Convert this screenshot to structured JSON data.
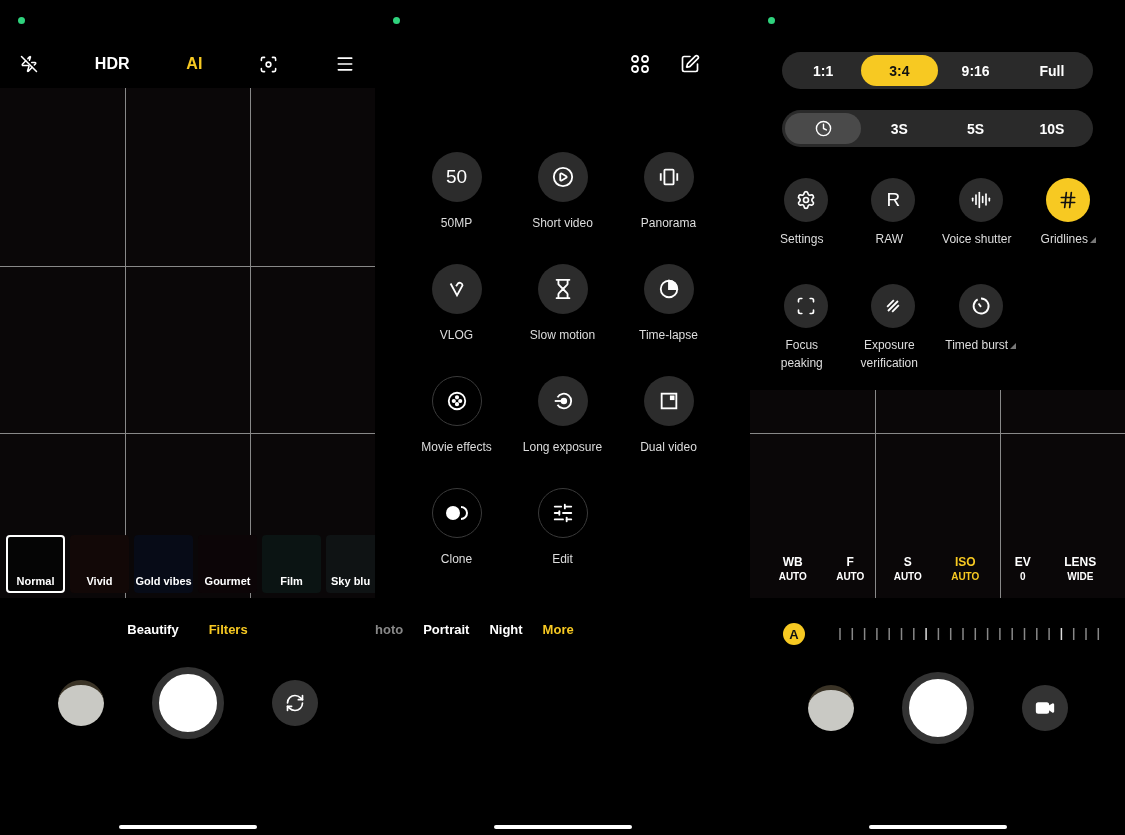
{
  "filter_screen": {
    "top_bar": [
      {
        "label": "HDR",
        "selected": false
      },
      {
        "label": "AI",
        "selected": true
      }
    ],
    "filters": [
      {
        "label": "Normal",
        "selected": true,
        "color": "#050505"
      },
      {
        "label": "Vivid",
        "selected": false,
        "color": "#120807"
      },
      {
        "label": "Gold vibes",
        "selected": false,
        "color": "#070b17"
      },
      {
        "label": "Gourmet",
        "selected": false,
        "color": "#0c0507"
      },
      {
        "label": "Film",
        "selected": false,
        "color": "#0b1413"
      },
      {
        "label": "Sky blu",
        "selected": false,
        "color": "#0f1314"
      }
    ],
    "tabs": [
      {
        "label": "Beautify",
        "selected": false
      },
      {
        "label": "Filters",
        "selected": true
      }
    ]
  },
  "more_screen": {
    "modes": [
      {
        "label": "50MP",
        "kind": "filled",
        "glyph": "50"
      },
      {
        "label": "Short video",
        "kind": "filled"
      },
      {
        "label": "Panorama",
        "kind": "filled"
      },
      {
        "label": "VLOG",
        "kind": "filled"
      },
      {
        "label": "Slow motion",
        "kind": "filled"
      },
      {
        "label": "Time-lapse",
        "kind": "filled"
      },
      {
        "label": "Movie effects",
        "kind": "outlined"
      },
      {
        "label": "Long exposure",
        "kind": "filled"
      },
      {
        "label": "Dual video",
        "kind": "filled"
      },
      {
        "label": "Clone",
        "kind": "outlined"
      },
      {
        "label": "Edit",
        "kind": "outlined"
      }
    ],
    "tabs": [
      {
        "label": "hoto",
        "selected": false
      },
      {
        "label": "Portrait",
        "selected": false
      },
      {
        "label": "Night",
        "selected": false
      },
      {
        "label": "More",
        "selected": true
      }
    ]
  },
  "pro_screen": {
    "aspect_ratios": [
      {
        "label": "1:1",
        "selected": false
      },
      {
        "label": "3:4",
        "selected": true
      },
      {
        "label": "9:16",
        "selected": false
      },
      {
        "label": "Full",
        "selected": false
      }
    ],
    "timers": [
      {
        "kind": "icon",
        "selected": true
      },
      {
        "kind": "text",
        "label": "3S",
        "selected": false
      },
      {
        "kind": "text",
        "label": "5S",
        "selected": false
      },
      {
        "kind": "text",
        "label": "10S",
        "selected": false
      }
    ],
    "toggles": [
      {
        "label": "Settings",
        "on": false,
        "expandable": false
      },
      {
        "label": "RAW",
        "on": false,
        "expandable": false,
        "glyph": "R"
      },
      {
        "label": "Voice shutter",
        "on": false,
        "expandable": false
      },
      {
        "label": "Gridlines",
        "on": true,
        "expandable": true
      },
      {
        "label": "Focus peaking",
        "on": false,
        "expandable": false
      },
      {
        "label": "Exposure verification",
        "on": false,
        "expandable": false
      },
      {
        "label": "Timed burst",
        "on": false,
        "expandable": true
      }
    ],
    "pro_params": [
      {
        "name": "WB",
        "value": "AUTO",
        "selected": false
      },
      {
        "name": "F",
        "value": "AUTO",
        "selected": false
      },
      {
        "name": "S",
        "value": "AUTO",
        "selected": false
      },
      {
        "name": "ISO",
        "value": "AUTO",
        "selected": true
      },
      {
        "name": "EV",
        "value": "0",
        "selected": false
      },
      {
        "name": "LENS",
        "value": "WIDE",
        "selected": false
      }
    ],
    "dial": {
      "label": "A"
    }
  }
}
